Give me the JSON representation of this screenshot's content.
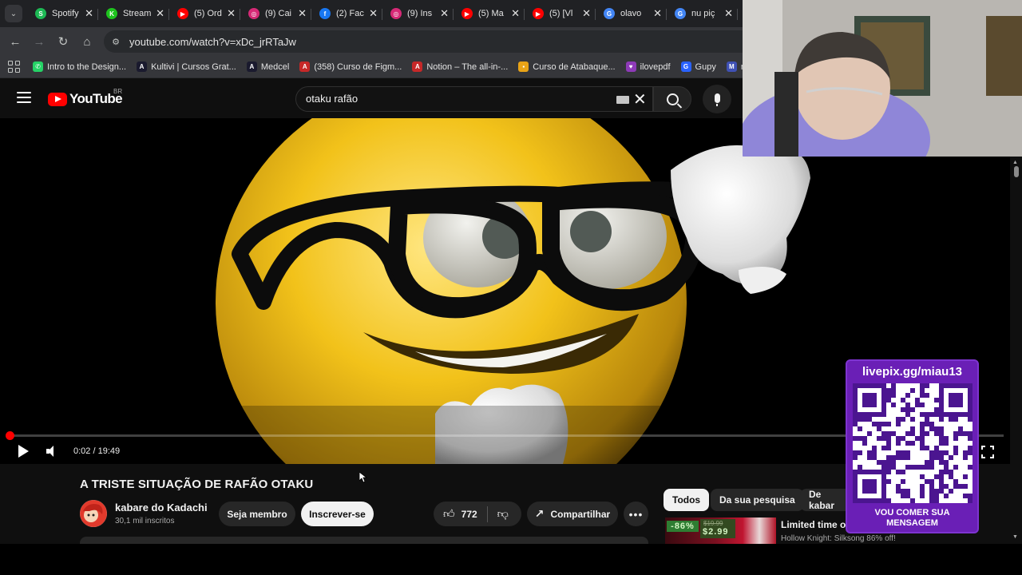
{
  "tabs": [
    {
      "title": "Spotify",
      "fav": "S",
      "color": "#1db954",
      "icon": "spotify-icon"
    },
    {
      "title": "Stream",
      "fav": "K",
      "color": "#1ec31e",
      "icon": "kick-icon"
    },
    {
      "title": "(5) Ord",
      "fav": "▶",
      "color": "#ff0000",
      "icon": "youtube-icon"
    },
    {
      "title": "(9) Cai",
      "fav": "◎",
      "color": "#d62976",
      "icon": "instagram-icon"
    },
    {
      "title": "(2) Fac",
      "fav": "f",
      "color": "#1877f2",
      "icon": "facebook-icon"
    },
    {
      "title": "(9) Ins",
      "fav": "◎",
      "color": "#d62976",
      "icon": "instagram-icon"
    },
    {
      "title": "(5) Ma",
      "fav": "▶",
      "color": "#ff0000",
      "icon": "youtube-icon"
    },
    {
      "title": "(5) [Vl",
      "fav": "▶",
      "color": "#ff0000",
      "icon": "youtube-icon"
    },
    {
      "title": "olavo",
      "fav": "G",
      "color": "#4285f4",
      "icon": "google-icon"
    },
    {
      "title": "nu piç",
      "fav": "G",
      "color": "#4285f4",
      "icon": "google-icon"
    }
  ],
  "address": {
    "url": "youtube.com/watch?v=xDc_jrRTaJw"
  },
  "bookmarks": [
    {
      "label": "Intro to the Design...",
      "fav": "✆",
      "color": "#25d366",
      "icon": "whatsapp-icon"
    },
    {
      "label": "Kultivi | Cursos Grat...",
      "fav": "A",
      "color": "#1a1a2e",
      "icon": "kultivi-icon"
    },
    {
      "label": "Medcel",
      "fav": "A",
      "color": "#1a1a2e",
      "icon": "medcel-icon"
    },
    {
      "label": "(358) Curso de Figm...",
      "fav": "A",
      "color": "#c62828",
      "icon": "adobe-icon"
    },
    {
      "label": "Notion – The all-in-...",
      "fav": "A",
      "color": "#c62828",
      "icon": "adobe-icon"
    },
    {
      "label": "Curso de Atabaque...",
      "fav": "▪",
      "color": "#e8a317",
      "icon": "atabaque-icon"
    },
    {
      "label": "ilovepdf",
      "fav": "♥",
      "color": "#8e3ab8",
      "icon": "ilovepdf-icon"
    },
    {
      "label": "Gupy",
      "fav": "G",
      "color": "#2962ff",
      "icon": "gupy-icon"
    },
    {
      "label": "mods",
      "fav": "M",
      "color": "#3f51b5",
      "icon": "mods-icon"
    }
  ],
  "yt": {
    "logo": "YouTube",
    "country": "BR",
    "search_query": "otaku rafão"
  },
  "player": {
    "current_time": "0:02",
    "duration": "19:49",
    "time_display": "0:02 / 19:49",
    "progress_fraction": 0.0017
  },
  "video": {
    "title": "A TRISTE SITUAÇÃO DE RAFÃO OTAKU",
    "channel": "kabare do Kadachi",
    "subscribers": "30,1 mil inscritos",
    "member_label": "Seja membro",
    "subscribe_label": "Inscrever-se",
    "likes": "772",
    "share_label": "Compartilhar"
  },
  "chips": [
    "Todos",
    "Da sua pesquisa",
    "De kabar"
  ],
  "recommendation": {
    "discount": "-86%",
    "old_price": "$19.99",
    "new_price": "$2.99",
    "title": "Limited time off",
    "subtitle": "Hollow Knight: Silksong 86% off!"
  },
  "overlay": {
    "url": "livepix.gg/miau13",
    "caption_line1": "VOU COMER SUA",
    "caption_line2": "MENSAGEM"
  },
  "colors": {
    "youtube_red": "#ff0000",
    "overlay_purple": "#6a1fb6",
    "emoji_yellow": "#f2c21a"
  }
}
